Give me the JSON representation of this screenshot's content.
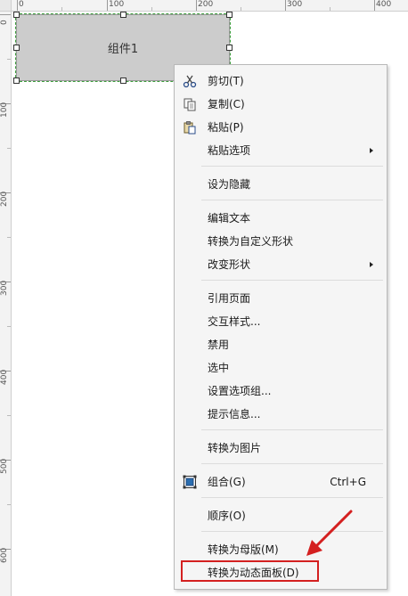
{
  "ruler": {
    "top_labels": [
      "0",
      "100",
      "200",
      "300",
      "400"
    ],
    "left_labels": [
      "0",
      "100",
      "200",
      "300",
      "400",
      "500",
      "600"
    ]
  },
  "widget": {
    "label": "组件1"
  },
  "context_menu": {
    "items": [
      {
        "label": "剪切(T)",
        "icon": "scissors-icon"
      },
      {
        "label": "复制(C)",
        "icon": "copy-icon"
      },
      {
        "label": "粘贴(P)",
        "icon": "paste-icon"
      },
      {
        "label": "粘贴选项",
        "submenu": true
      },
      {
        "label": "设为隐藏"
      },
      {
        "label": "编辑文本"
      },
      {
        "label": "转换为自定义形状"
      },
      {
        "label": "改变形状",
        "submenu": true
      },
      {
        "label": "引用页面"
      },
      {
        "label": "交互样式..."
      },
      {
        "label": "禁用"
      },
      {
        "label": "选中"
      },
      {
        "label": "设置选项组..."
      },
      {
        "label": "提示信息..."
      },
      {
        "label": "转换为图片"
      },
      {
        "label": "组合(G)",
        "shortcut": "Ctrl+G",
        "icon": "group-icon"
      },
      {
        "label": "顺序(O)"
      },
      {
        "label": "转换为母版(M)"
      },
      {
        "label": "转换为动态面板(D)",
        "highlighted": true
      }
    ]
  },
  "colors": {
    "highlight": "#d42020",
    "widget_fill": "#cccccc",
    "selection_outline": "#3b9c3b"
  }
}
